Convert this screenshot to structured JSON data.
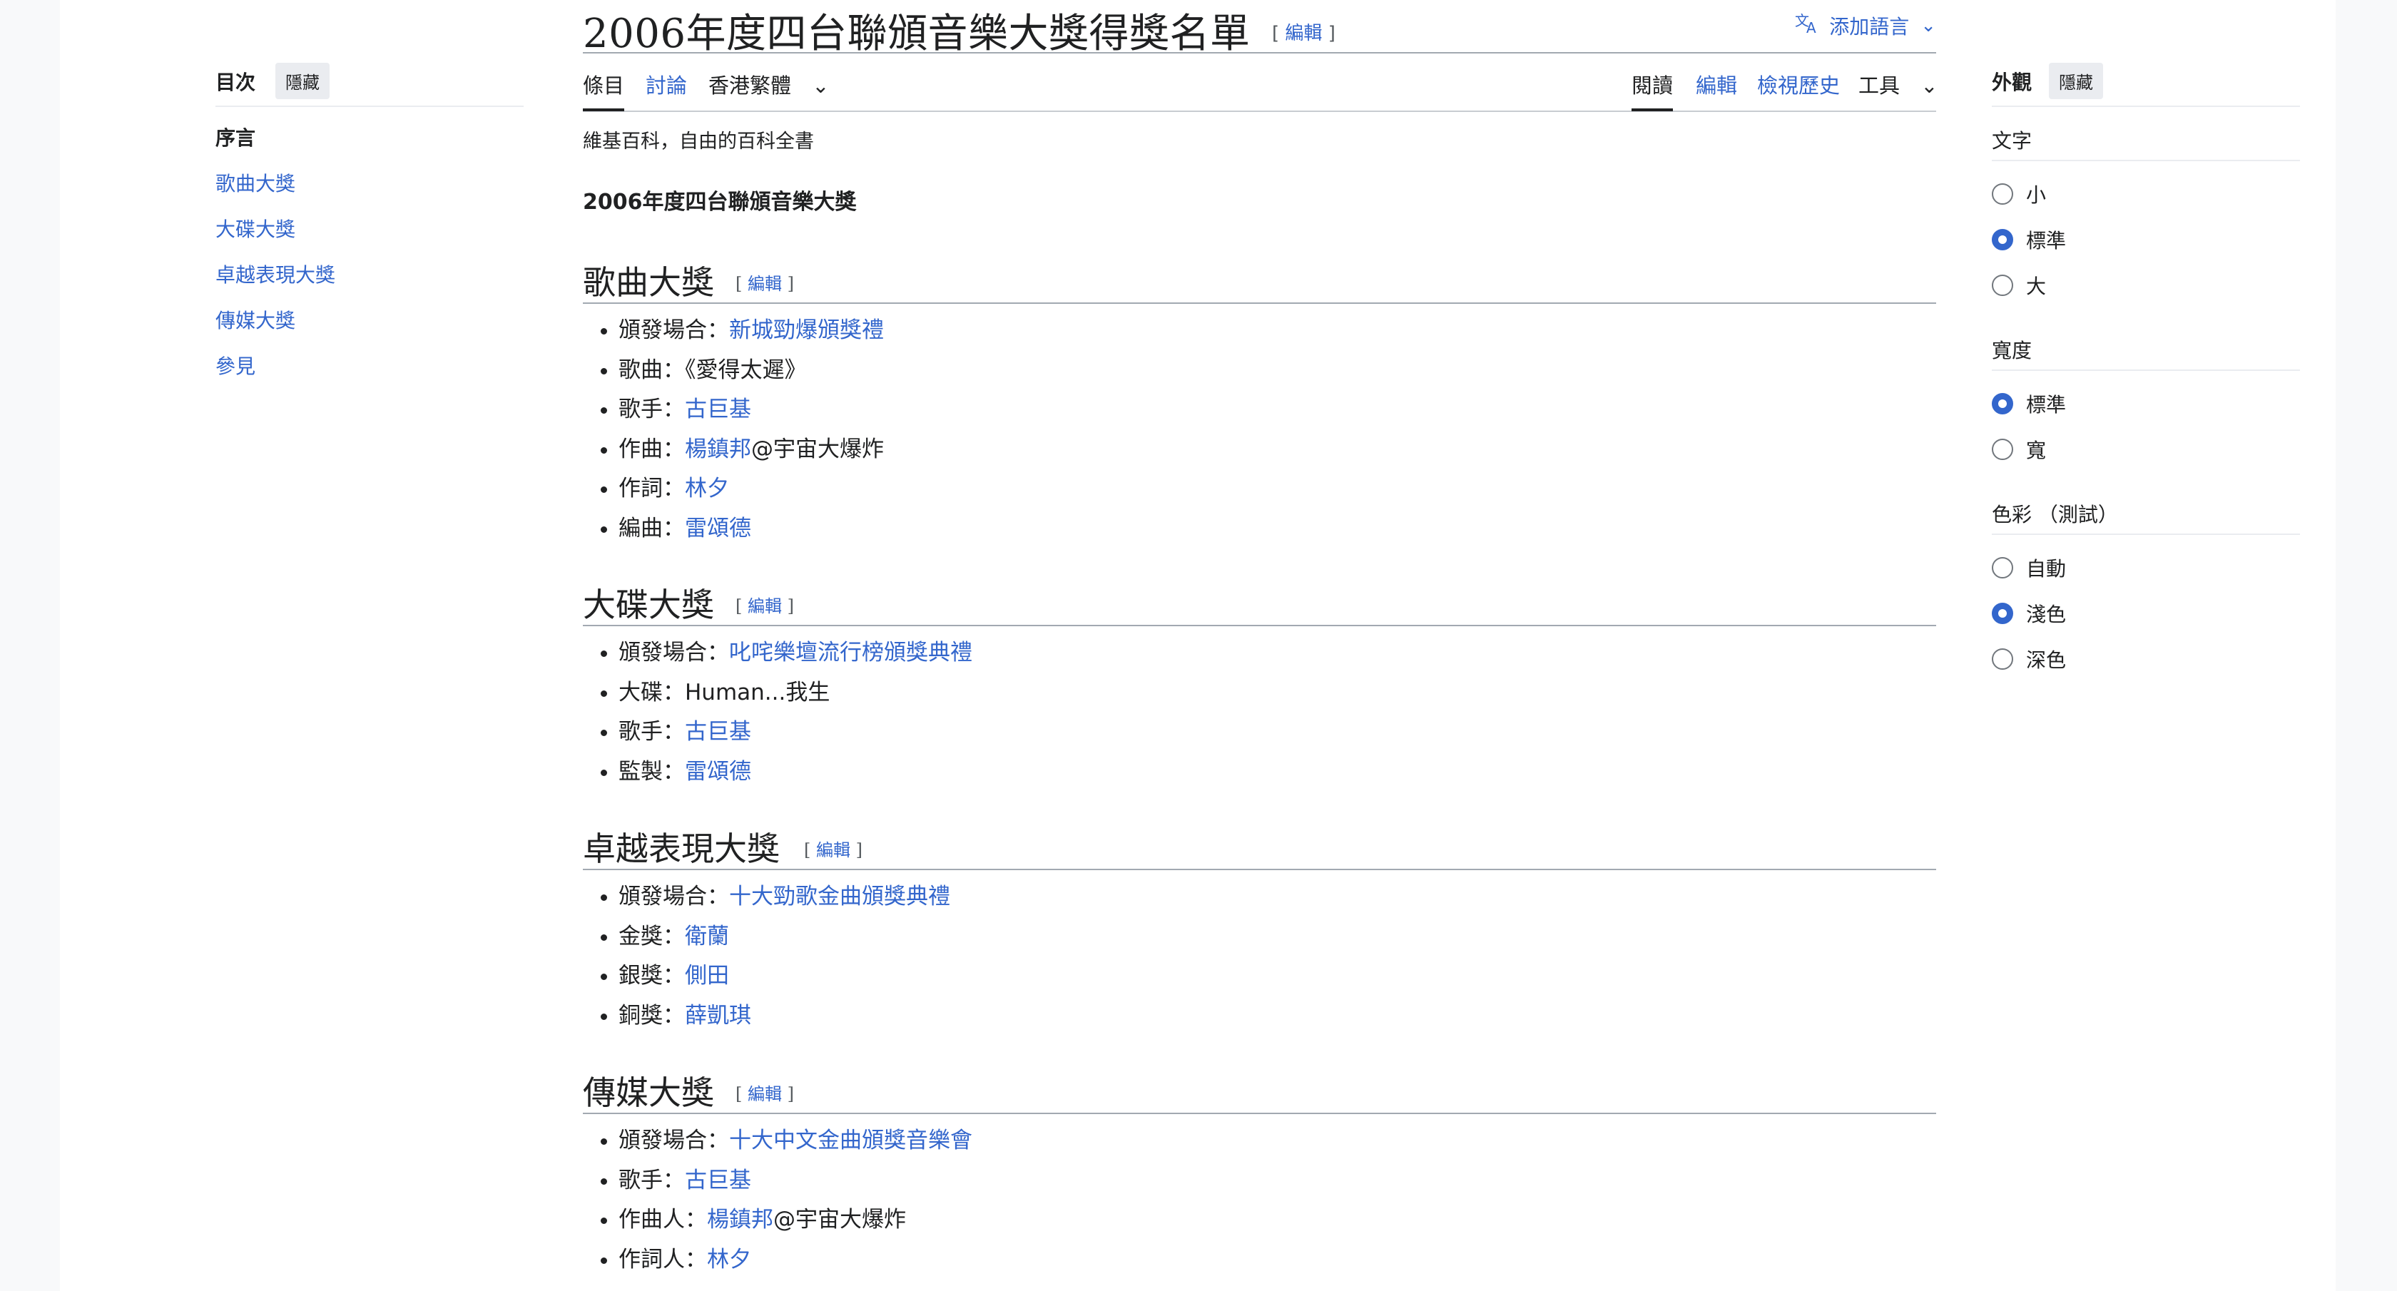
{
  "title": "2006年度四台聯頒音樂大獎得獎名單",
  "title_edit": "編輯",
  "lang_button": "添加語言",
  "tabs_left": {
    "article": "條目",
    "talk": "討論",
    "variant": "香港繁體"
  },
  "tabs_right": {
    "read": "閱讀",
    "edit": "編輯",
    "history": "檢視歷史",
    "tools": "工具"
  },
  "toc": {
    "label": "目次",
    "hide": "隱藏",
    "items": [
      "序言",
      "歌曲大獎",
      "大碟大獎",
      "卓越表現大獎",
      "傳媒大獎",
      "參見"
    ]
  },
  "tagline": "維基百科，自由的百科全書",
  "lead": "2006年度四台聯頒音樂大獎",
  "edit_label": "編輯",
  "sections": [
    {
      "heading": "歌曲大獎",
      "items": [
        {
          "k": "頒發場合：",
          "v": "新城勁爆頒獎禮",
          "rest": ""
        },
        {
          "k": "歌曲：《愛得太遲》",
          "v": "",
          "rest": ""
        },
        {
          "k": "歌手：",
          "v": "古巨基",
          "rest": ""
        },
        {
          "k": "作曲：",
          "v": "楊鎮邦",
          "rest": "@宇宙大爆炸"
        },
        {
          "k": "作詞：",
          "v": "林夕",
          "rest": ""
        },
        {
          "k": "編曲：",
          "v": "雷頌德",
          "rest": ""
        }
      ]
    },
    {
      "heading": "大碟大獎",
      "items": [
        {
          "k": "頒發場合：",
          "v": "叱咤樂壇流行榜頒獎典禮",
          "rest": ""
        },
        {
          "k": "大碟：Human...我生",
          "v": "",
          "rest": ""
        },
        {
          "k": "歌手：",
          "v": "古巨基",
          "rest": ""
        },
        {
          "k": "監製：",
          "v": "雷頌德",
          "rest": ""
        }
      ]
    },
    {
      "heading": "卓越表現大獎",
      "items": [
        {
          "k": "頒發場合：",
          "v": "十大勁歌金曲頒獎典禮",
          "rest": ""
        },
        {
          "k": "金獎：",
          "v": "衛蘭",
          "rest": ""
        },
        {
          "k": "銀獎：",
          "v": "側田",
          "rest": ""
        },
        {
          "k": "銅獎：",
          "v": "薛凱琪",
          "rest": ""
        }
      ]
    },
    {
      "heading": "傳媒大獎",
      "items": [
        {
          "k": "頒發場合：",
          "v": "十大中文金曲頒獎音樂會",
          "rest": ""
        },
        {
          "k": "歌手：",
          "v": "古巨基",
          "rest": ""
        },
        {
          "k": "作曲人：",
          "v": "楊鎮邦",
          "rest": "@宇宙大爆炸"
        },
        {
          "k": "作詞人：",
          "v": "林夕",
          "rest": ""
        }
      ]
    }
  ],
  "appearance": {
    "label": "外觀",
    "hide": "隱藏",
    "text_group": "文字",
    "text_options": [
      "小",
      "標準",
      "大"
    ],
    "text_selected": "標準",
    "width_group": "寬度",
    "width_options": [
      "標準",
      "寬"
    ],
    "width_selected": "標準",
    "color_group": "色彩 （測試）",
    "color_options": [
      "自動",
      "淺色",
      "深色"
    ],
    "color_selected": "淺色"
  },
  "colors": {
    "link": "#3366cc",
    "text": "#202122",
    "border": "#a2a9b1"
  }
}
